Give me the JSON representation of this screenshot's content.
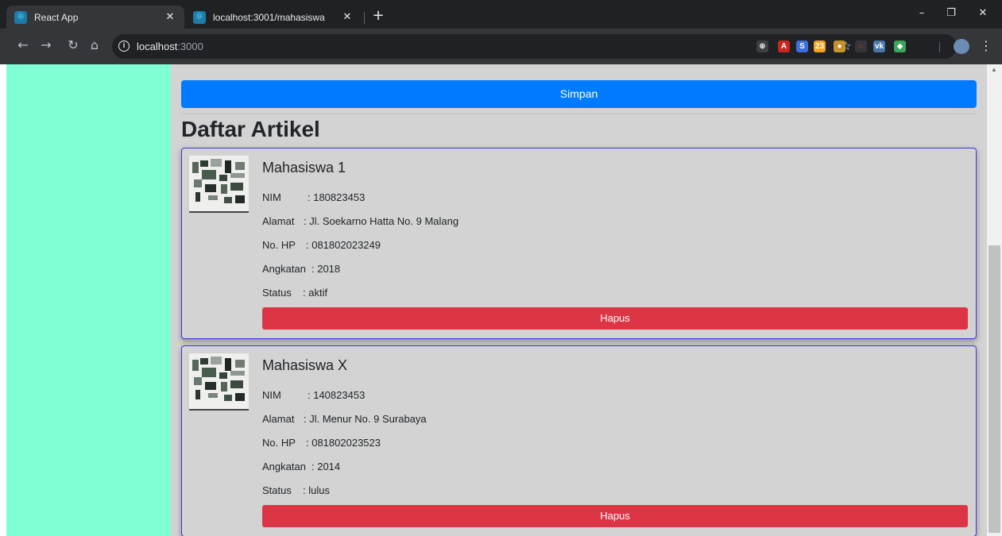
{
  "browser": {
    "tabs": [
      {
        "title": "React App",
        "active": true
      },
      {
        "title": "localhost:3001/mahasiswa",
        "active": false
      }
    ],
    "new_tab_label": "+",
    "window_controls": {
      "minimize": "–",
      "restore": "❐",
      "close": "✕"
    },
    "nav": {
      "back": "←",
      "forward": "→",
      "reload": "↻",
      "home": "⌂"
    },
    "address": {
      "host": "localhost",
      "port": ":3000"
    },
    "extensions": [
      {
        "name": "h-extension-icon",
        "glyph": "⊕",
        "color": "#3c4043"
      },
      {
        "name": "acrobat-icon",
        "glyph": "A",
        "color": "#c8261f"
      },
      {
        "name": "s-extension-icon",
        "glyph": "S",
        "color": "#3d6fdb"
      },
      {
        "name": "calendar-icon",
        "glyph": "23",
        "color": "#f4a21f"
      },
      {
        "name": "cookie-icon",
        "glyph": "●",
        "color": "#c7912c"
      },
      {
        "name": "red-circle-icon",
        "glyph": "○",
        "color": "#35363a"
      },
      {
        "name": "vk-icon",
        "glyph": "vk",
        "color": "#4a76a8"
      },
      {
        "name": "green-extension-icon",
        "glyph": "◆",
        "color": "#3ba55d"
      }
    ],
    "colors": {
      "tabbar": "#202124",
      "toolbar": "#35363a"
    }
  },
  "page": {
    "save_label": "Simpan",
    "section_title": "Daftar Artikel",
    "colors": {
      "sidebar": "#7fffd4",
      "main": "#d3d3d3",
      "primary": "#007bff",
      "danger": "#dc3545",
      "card_border": "#3a3ad8"
    },
    "labels": {
      "nim": "NIM",
      "alamat": "Alamat",
      "hp": "No. HP",
      "angkatan": "Angkatan",
      "status": "Status"
    },
    "cards": [
      {
        "name": "Mahasiswa 1",
        "nim": ": 180823453",
        "alamat": ": Jl. Soekarno Hatta No. 9 Malang",
        "hp": ": 081802023249",
        "angkatan": ": 2018",
        "status": ": aktif",
        "delete_label": "Hapus"
      },
      {
        "name": "Mahasiswa X",
        "nim": ": 140823453",
        "alamat": ": Jl. Menur No. 9 Surabaya",
        "hp": ": 081802023523",
        "angkatan": ": 2014",
        "status": ": lulus",
        "delete_label": "Hapus"
      }
    ]
  }
}
